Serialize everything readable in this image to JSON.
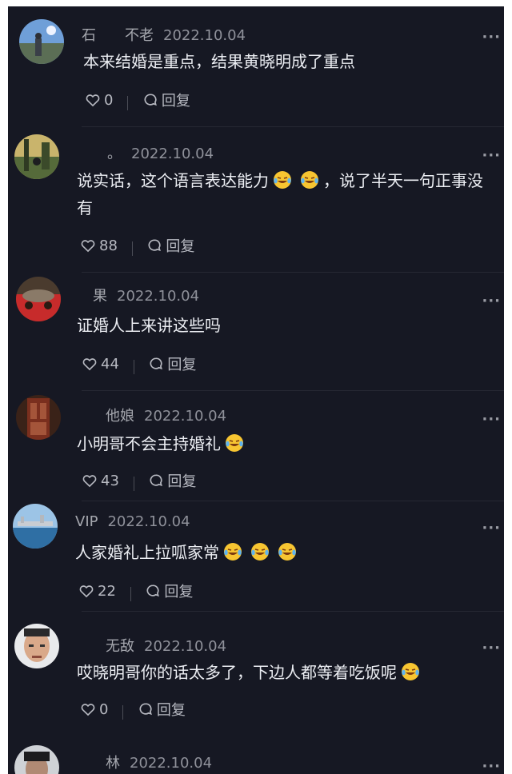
{
  "comments": [
    {
      "username": "石　　不老",
      "date": "2022.10.04",
      "text": "本来结婚是重点，结果黄晓明成了重点",
      "emoji_count": 0,
      "likes": "0",
      "reply_label": "回复"
    },
    {
      "username": "　　。",
      "date": "2022.10.04",
      "text_before": "说实话，这个语言表达能力",
      "text_after": "，说了半天一句正事没有",
      "emoji_count": 2,
      "likes": "88",
      "reply_label": "回复"
    },
    {
      "username": "　果",
      "date": "2022.10.04",
      "text": "证婚人上来讲这些吗",
      "emoji_count": 0,
      "likes": "44",
      "reply_label": "回复"
    },
    {
      "username": "　　他娘",
      "date": "2022.10.04",
      "text": "小明哥不会主持婚礼",
      "emoji_count": 1,
      "likes": "43",
      "reply_label": "回复"
    },
    {
      "username": "VIP",
      "date": "2022.10.04",
      "text": "人家婚礼上拉呱家常",
      "emoji_count": 3,
      "likes": "22",
      "reply_label": "回复"
    },
    {
      "username": "　　无敌",
      "date": "2022.10.04",
      "text": "哎晓明哥你的话太多了，下边人都等着吃饭呢",
      "emoji_count": 1,
      "likes": "0",
      "reply_label": "回复"
    },
    {
      "username": "　　林",
      "date": "2022.10.04"
    }
  ],
  "icons": {
    "more": "more-dots-icon",
    "like": "heart-outline-icon",
    "reply": "speech-bubble-icon",
    "emoji": "laughing-tears-emoji"
  },
  "colors": {
    "background": "#161823",
    "text": "#eceef3",
    "secondary": "#8f919a"
  }
}
